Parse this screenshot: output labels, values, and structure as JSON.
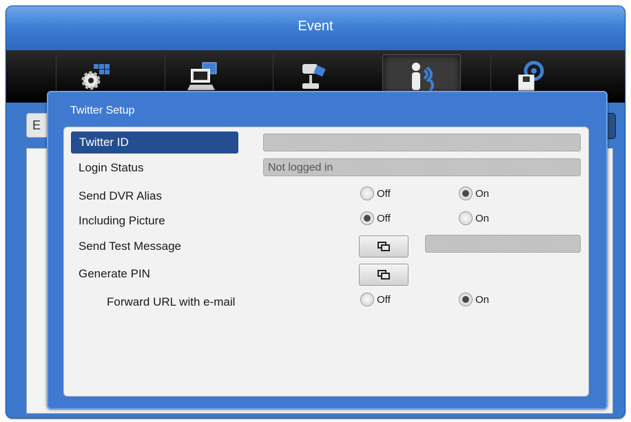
{
  "window": {
    "title": "Event"
  },
  "toolbar": {
    "tools": [
      {
        "icon": "settings-grid-icon",
        "active": false
      },
      {
        "icon": "network-computer-icon",
        "active": false
      },
      {
        "icon": "camera-joystick-icon",
        "active": false
      },
      {
        "icon": "person-waves-icon",
        "active": true
      },
      {
        "icon": "storage-disk-icon",
        "active": false
      }
    ]
  },
  "underlying": {
    "tab_label": "E"
  },
  "dialog": {
    "title": "Twitter Setup",
    "rows": {
      "twitter_id": {
        "label": "Twitter ID",
        "value": ""
      },
      "login_status": {
        "label": "Login Status",
        "value": "Not logged in"
      },
      "send_dvr_alias": {
        "label": "Send DVR Alias",
        "off": "Off",
        "on": "On",
        "selected": "On"
      },
      "including_picture": {
        "label": "Including Picture",
        "off": "Off",
        "on": "On",
        "selected": "Off"
      },
      "send_test_message": {
        "label": "Send Test Message",
        "result": ""
      },
      "generate_pin": {
        "label": "Generate PIN"
      },
      "forward_url": {
        "label": "Forward URL with e-mail",
        "off": "Off",
        "on": "On",
        "selected": "On"
      }
    }
  },
  "colors": {
    "accent": "#244e90",
    "panel": "#3f7ad0",
    "title_bar": "#3f80d6"
  }
}
